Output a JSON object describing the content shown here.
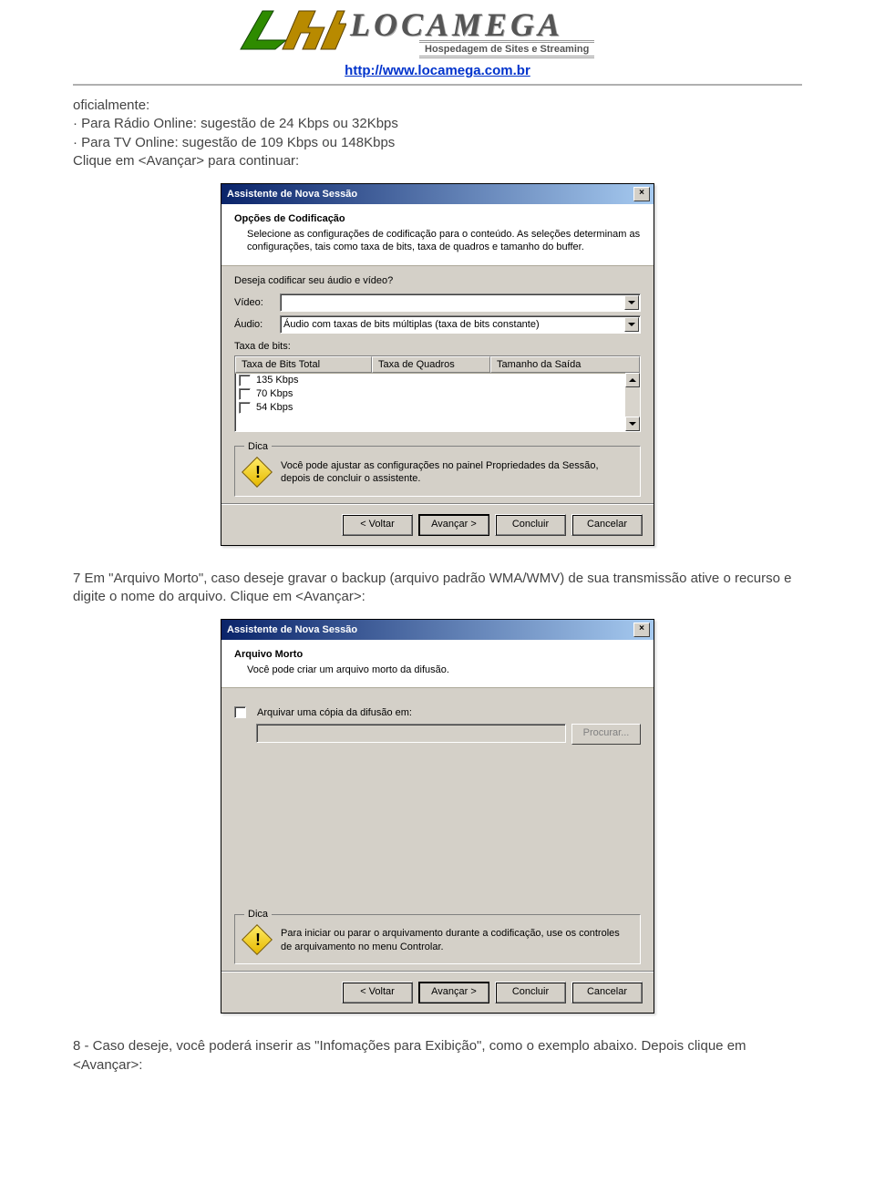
{
  "header": {
    "logo_text": "LOCAMEGA",
    "logo_sub": "Hospedagem de Sites e Streaming",
    "url": "http://www.locamega.com.br"
  },
  "intro": {
    "line1": "oficialmente:",
    "line2": "· Para Rádio Online: sugestão de 24 Kbps ou 32Kbps",
    "line3": "· Para TV Online: sugestão de 109 Kbps ou 148Kbps",
    "line4": "Clique em <Avançar> para continuar:"
  },
  "dialog1": {
    "title": "Assistente de Nova Sessão",
    "section_title": "Opções de Codificação",
    "section_desc": "Selecione as configurações de codificação para o conteúdo. As seleções determinam as configurações, tais como taxa de bits, taxa de quadros e tamanho do buffer.",
    "question": "Deseja codificar seu áudio e vídeo?",
    "video_label": "Vídeo:",
    "video_value": "",
    "audio_label": "Áudio:",
    "audio_value": "Áudio com taxas de bits múltiplas (taxa de bits constante)",
    "rate_label": "Taxa de bits:",
    "cols": {
      "c1": "Taxa de Bits Total",
      "c2": "Taxa de Quadros",
      "c3": "Tamanho da Saída"
    },
    "rows": [
      "135 Kbps",
      "70 Kbps",
      "54 Kbps"
    ],
    "tip_legend": "Dica",
    "tip_text": "Você pode ajustar as configurações no painel Propriedades da Sessão, depois de concluir o assistente.",
    "buttons": {
      "back": "< Voltar",
      "next": "Avançar >",
      "finish": "Concluir",
      "cancel": "Cancelar"
    }
  },
  "mid_text": "7 Em \"Arquivo Morto\", caso deseje gravar o backup (arquivo padrão WMA/WMV) de sua transmissão ative o recurso e digite o nome do arquivo. Clique em <Avançar>:",
  "dialog2": {
    "title": "Assistente de Nova Sessão",
    "section_title": "Arquivo Morto",
    "section_desc": "Você pode criar um arquivo morto da difusão.",
    "checkbox_label": "Arquivar uma cópia da difusão em:",
    "browse": "Procurar...",
    "tip_legend": "Dica",
    "tip_text": "Para iniciar ou parar o arquivamento durante a codificação, use os controles de arquivamento no menu Controlar.",
    "buttons": {
      "back": "< Voltar",
      "next": "Avançar >",
      "finish": "Concluir",
      "cancel": "Cancelar"
    }
  },
  "end_text": "8 - Caso deseje, você poderá inserir as \"Infomações para Exibição\", como o exemplo abaixo. Depois clique em <Avançar>:"
}
